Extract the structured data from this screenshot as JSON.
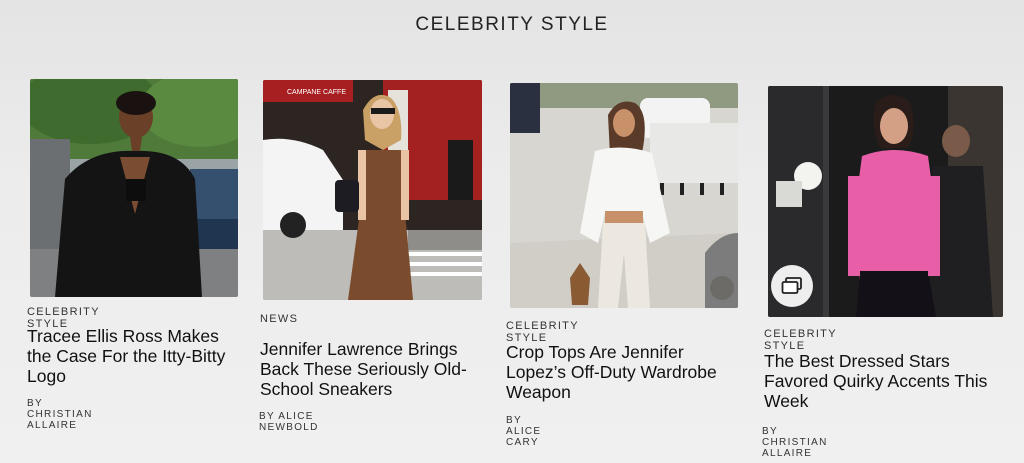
{
  "section": {
    "title": "CELEBRITY STYLE"
  },
  "cards": [
    {
      "kicker": "CELEBRITY STYLE",
      "headline": "Tracee Ellis Ross Makes the Case For the Itty-Bitty Logo",
      "byline": "BY CHRISTIAN ALLAIRE"
    },
    {
      "kicker": "NEWS",
      "headline": "Jennifer Lawrence Brings Back These Seriously Old-School Sneakers",
      "byline": "BY ALICE NEWBOLD",
      "sign": "CAMPANE  CAFFE"
    },
    {
      "kicker": "CELEBRITY STYLE",
      "headline": "Crop Tops Are Jennifer Lopez’s Off-Duty Wardrobe Weapon",
      "byline": "BY ALICE CARY"
    },
    {
      "kicker": "CELEBRITY STYLE",
      "headline": "The Best Dressed Stars Favored Quirky Accents This Week",
      "byline": "BY CHRISTIAN ALLAIRE",
      "gallery_icon": "gallery-icon"
    }
  ]
}
